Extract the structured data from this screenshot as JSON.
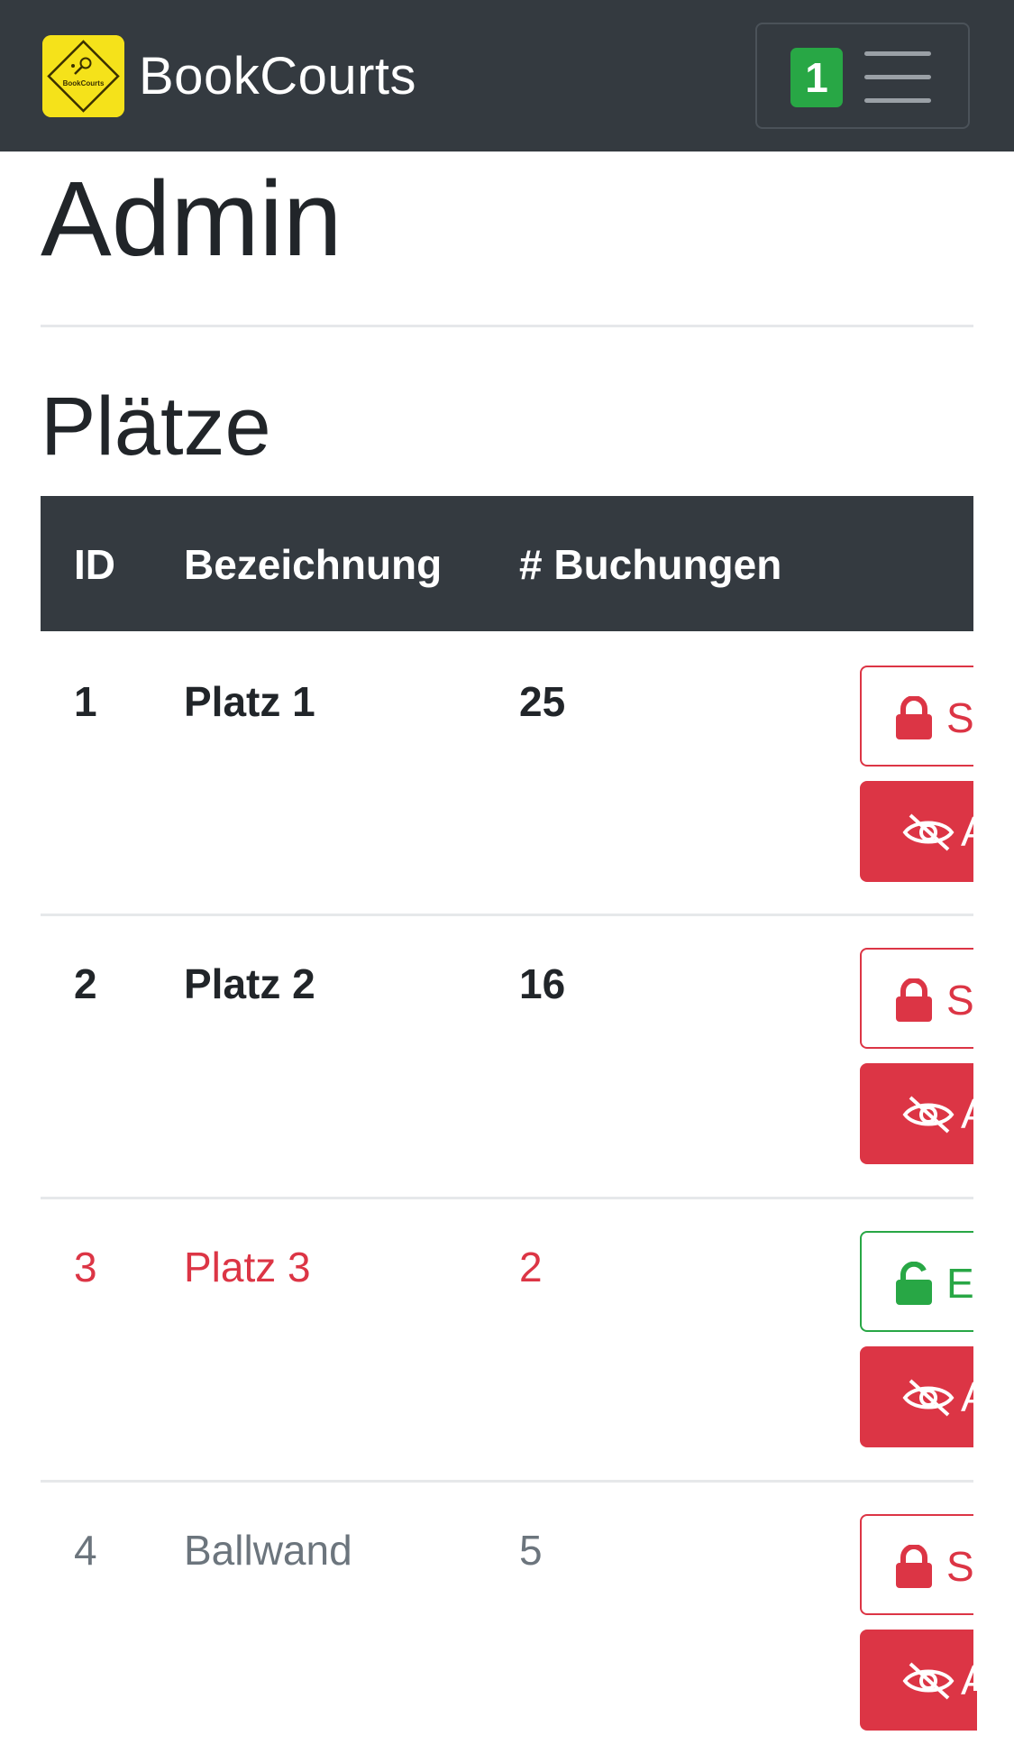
{
  "navbar": {
    "brand_name": "BookCourts",
    "logo_text": "BookCourts",
    "notification_count": "1"
  },
  "page": {
    "title": "Admin",
    "section_title": "Plätze"
  },
  "table": {
    "headers": [
      "ID",
      "Bezeichnung",
      "# Buchungen"
    ],
    "rows": [
      {
        "id": "1",
        "name": "Platz 1",
        "bookings": "25",
        "lock_label": "Sperren",
        "hide_label": "Ausblenden",
        "state": "active"
      },
      {
        "id": "2",
        "name": "Platz 2",
        "bookings": "16",
        "lock_label": "Sperren",
        "hide_label": "Ausblenden",
        "state": "active"
      },
      {
        "id": "3",
        "name": "Platz 3",
        "bookings": "2",
        "lock_label": "Entsperren",
        "hide_label": "Ausblenden",
        "state": "locked"
      },
      {
        "id": "4",
        "name": "Ballwand",
        "bookings": "5",
        "lock_label": "Sperren",
        "hide_label": "Ausblenden",
        "state": "hidden"
      }
    ]
  },
  "colors": {
    "navbar_bg": "#343a40",
    "danger": "#dc3545",
    "success": "#28a745",
    "muted": "#6c757d",
    "logo_yellow": "#f5e21a"
  }
}
